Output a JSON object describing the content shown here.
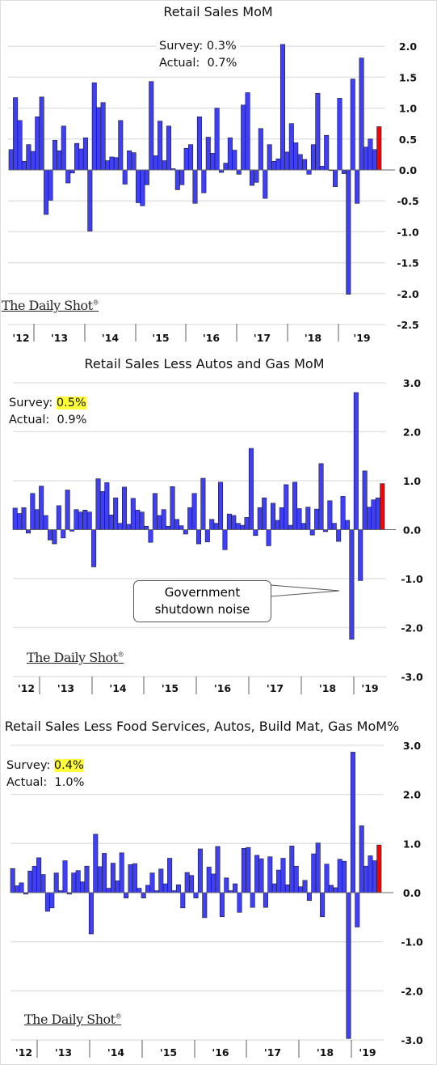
{
  "colors": {
    "bar": "#3f3ff5",
    "latest_bar": "#ff0000",
    "highlight": "#ffff3a"
  },
  "logo_text": "The Daily Shot",
  "year_labels": [
    "'12",
    "'13",
    "'14",
    "'15",
    "'16",
    "'17",
    "'18",
    "'19"
  ],
  "chart_data": [
    {
      "type": "bar",
      "title": "Retail Sales MoM",
      "survey_label": "Survey:",
      "survey_value": "0.3%",
      "actual_label": "Actual:",
      "actual_value": "0.7%",
      "ylim": [
        -2.5,
        2.0
      ],
      "yticks": [
        "2.0",
        "1.5",
        "1.0",
        "0.5",
        "0.0",
        "-0.5",
        "-1.0",
        "-1.5",
        "-2.0",
        "-2.5"
      ],
      "ytick_values": [
        2.0,
        1.5,
        1.0,
        0.5,
        0.0,
        -0.5,
        -1.0,
        -1.5,
        -2.0,
        -2.5
      ],
      "grid": true,
      "values": [
        0.33,
        1.17,
        0.8,
        0.14,
        0.41,
        0.3,
        0.86,
        1.18,
        -0.72,
        -0.49,
        0.48,
        0.31,
        0.71,
        -0.21,
        -0.05,
        0.43,
        0.34,
        0.52,
        -0.99,
        1.41,
        1.01,
        1.09,
        0.15,
        0.21,
        0.2,
        0.8,
        -0.23,
        0.31,
        0.28,
        -0.53,
        -0.58,
        -0.24,
        1.43,
        0.23,
        0.79,
        0.15,
        0.71,
        0.02,
        -0.32,
        -0.24,
        0.35,
        0.41,
        -0.54,
        0.86,
        -0.37,
        0.53,
        0.27,
        1.0,
        -0.04,
        0.11,
        0.52,
        0.32,
        -0.07,
        1.05,
        1.25,
        -0.25,
        -0.2,
        0.67,
        -0.46,
        0.41,
        0.14,
        0.18,
        2.03,
        0.29,
        0.75,
        0.44,
        0.25,
        0.17,
        -0.07,
        0.41,
        1.24,
        0.06,
        0.56,
        -0.01,
        -0.27,
        1.16,
        -0.06,
        -2.01,
        1.47,
        -0.54,
        1.81,
        0.37,
        0.5,
        0.33,
        0.7
      ]
    },
    {
      "type": "bar",
      "title": "Retail Sales Less Autos and Gas MoM",
      "survey_label": "Survey:",
      "survey_value": "0.5%",
      "actual_label": "Actual:",
      "actual_value": "0.9%",
      "annotation": [
        "Government",
        "shutdown noise"
      ],
      "ylim": [
        -3.0,
        3.0
      ],
      "yticks": [
        "3.0",
        "2.0",
        "1.0",
        "0.0",
        "-1.0",
        "-2.0",
        "-3.0"
      ],
      "ytick_values": [
        3,
        2,
        1,
        0,
        -1,
        -2,
        -3
      ],
      "grid": true,
      "values": [
        0.44,
        0.33,
        0.45,
        -0.07,
        0.74,
        0.41,
        0.89,
        0.29,
        -0.21,
        -0.29,
        0.49,
        -0.17,
        0.81,
        -0.03,
        0.41,
        0.36,
        0.4,
        0.36,
        -0.76,
        1.04,
        0.78,
        0.96,
        0.3,
        0.65,
        0.13,
        0.87,
        0.11,
        0.64,
        0.4,
        0.36,
        0.07,
        -0.26,
        0.74,
        0.29,
        0.41,
        0.07,
        0.88,
        0.21,
        0.08,
        -0.09,
        0.45,
        0.74,
        -0.29,
        1.05,
        -0.25,
        0.21,
        0.13,
        0.97,
        -0.41,
        0.32,
        0.29,
        0.13,
        0.09,
        0.25,
        1.66,
        -0.12,
        0.45,
        0.65,
        -0.33,
        0.54,
        0.19,
        0.45,
        0.92,
        0.09,
        0.97,
        0.43,
        0.13,
        0.46,
        -0.11,
        0.42,
        1.35,
        -0.04,
        0.59,
        0.13,
        -0.24,
        0.68,
        0.19,
        -2.24,
        2.8,
        -1.04,
        1.2,
        0.46,
        0.61,
        0.65,
        0.94
      ]
    },
    {
      "type": "bar",
      "title": "Retail Sales Less Food Services, Autos, Build Mat, Gas MoM%",
      "survey_label": "Survey:",
      "survey_value": "0.4%",
      "actual_label": "Actual:",
      "actual_value": "1.0%",
      "ylim": [
        -3.0,
        3.0
      ],
      "yticks": [
        "3.0",
        "2.0",
        "1.0",
        "0.0",
        "-1.0",
        "-2.0",
        "-3.0"
      ],
      "ytick_values": [
        3,
        2,
        1,
        0,
        -1,
        -2,
        -3
      ],
      "grid": true,
      "values": [
        0.49,
        0.14,
        0.2,
        -0.03,
        0.44,
        0.54,
        0.71,
        0.37,
        -0.38,
        -0.31,
        0.4,
        0.04,
        0.65,
        -0.03,
        0.4,
        0.45,
        0.22,
        0.54,
        -0.84,
        1.19,
        0.53,
        0.8,
        0.09,
        0.6,
        0.24,
        0.81,
        -0.11,
        0.57,
        0.59,
        0.09,
        -0.11,
        0.15,
        0.4,
        0.04,
        0.48,
        0.18,
        0.7,
        0.04,
        0.16,
        -0.31,
        0.41,
        0.35,
        -0.11,
        0.89,
        -0.51,
        0.52,
        0.38,
        0.94,
        -0.49,
        0.3,
        0.04,
        0.18,
        -0.4,
        0.9,
        0.92,
        -0.3,
        0.76,
        0.69,
        -0.3,
        0.73,
        0.18,
        0.46,
        0.7,
        0.16,
        0.95,
        0.54,
        0.12,
        0.25,
        -0.16,
        0.79,
        1.01,
        -0.49,
        0.58,
        0.15,
        0.1,
        0.68,
        0.64,
        -2.97,
        2.86,
        -0.7,
        1.36,
        0.54,
        0.75,
        0.65,
        0.97
      ]
    }
  ]
}
